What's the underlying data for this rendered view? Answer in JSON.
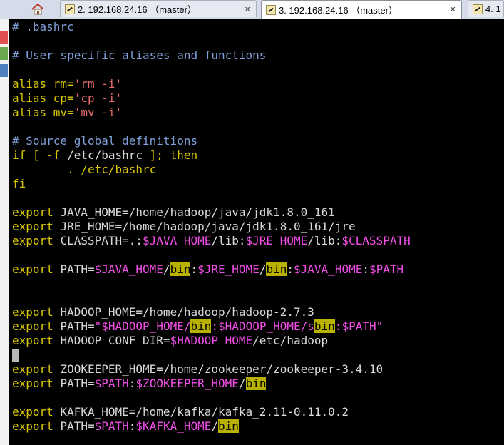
{
  "tabs": [
    {
      "label": "2.  192.168.24.16 （master）",
      "active": false
    },
    {
      "label": "3.  192.168.24.16 （master）",
      "active": true
    },
    {
      "label": "4. 1",
      "active": false
    }
  ],
  "close_glyph": "×",
  "terminal": {
    "lines": {
      "l1": "# .bashrc",
      "l3": "# User specific aliases and functions",
      "a1_kw": "alias ",
      "a1_name": "rm=",
      "a1_val": "'rm -i'",
      "a2_kw": "alias ",
      "a2_name": "cp=",
      "a2_val": "'cp -i'",
      "a3_kw": "alias ",
      "a3_name": "mv=",
      "a3_val": "'mv -i'",
      "c2": "# Source global definitions",
      "if_a": "if [ -f ",
      "if_b": "/etc/bashrc",
      "if_c": " ]; then",
      "src": "        . /etc/bashrc",
      "fi": "fi",
      "ex": "export ",
      "java_home": "JAVA_HOME=/home/hadoop/java/jdk1.8.0_161",
      "jre_home": "JRE_HOME=/home/hadoop/java/jdk1.8.0_161/jre",
      "cp_a": "CLASSPATH=.:",
      "cp_b": "$JAVA_HOME",
      "cp_c": "/lib:",
      "cp_d": "$JRE_HOME",
      "cp_e": "/lib:",
      "cp_f": "$CLASSPATH",
      "p1_a": "PATH=",
      "p1_b": "$JAVA_HOME",
      "p1_c": "/",
      "p1_d": "bin",
      "p1_e": ":",
      "p1_f": "$JRE_HOME",
      "p1_g": "/",
      "p1_h": "bin",
      "p1_i": ":",
      "p1_j": "$JAVA_HOME",
      "p1_k": ":",
      "p1_l": "$PATH",
      "hadoop_home": "HADOOP_HOME=/home/hadoop/hadoop-2.7.3",
      "p2_a": "PATH=",
      "p2_b": "\"",
      "p2_c": "$HADOOP_HOME",
      "p2_d": "/",
      "p2_e": "bin",
      "p2_f": ":",
      "p2_g": "$HADOOP_HOME",
      "p2_h": "/s",
      "p2_i": "bin",
      "p2_j": ":",
      "p2_k": "$PATH",
      "p2_l": "\"",
      "hc_a": "HADOOP_CONF_DIR=",
      "hc_b": "$HADOOP_HOME",
      "hc_c": "/etc/hadoop",
      "zk_home": "ZOOKEEPER_HOME=/home/zookeeper/zookeeper-3.4.10",
      "p3_a": "PATH=",
      "p3_b": "$PATH",
      "p3_c": ":",
      "p3_d": "$ZOOKEEPER_HOME",
      "p3_e": "/",
      "p3_f": "bin",
      "kf_home": "KAFKA_HOME=/home/kafka/kafka_2.11-0.11.0.2",
      "p4_a": "PATH=",
      "p4_b": "$PATH",
      "p4_c": ":",
      "p4_d": "$KAFKA_HOME",
      "p4_e": "/",
      "p4_f": "bin"
    }
  },
  "colors": {
    "comment": "#7f9fd8",
    "keyword": "#d8c600",
    "text": "#d8d8d8",
    "variable": "#f14ee8",
    "highlight": "#b8b100",
    "background": "#000000"
  }
}
